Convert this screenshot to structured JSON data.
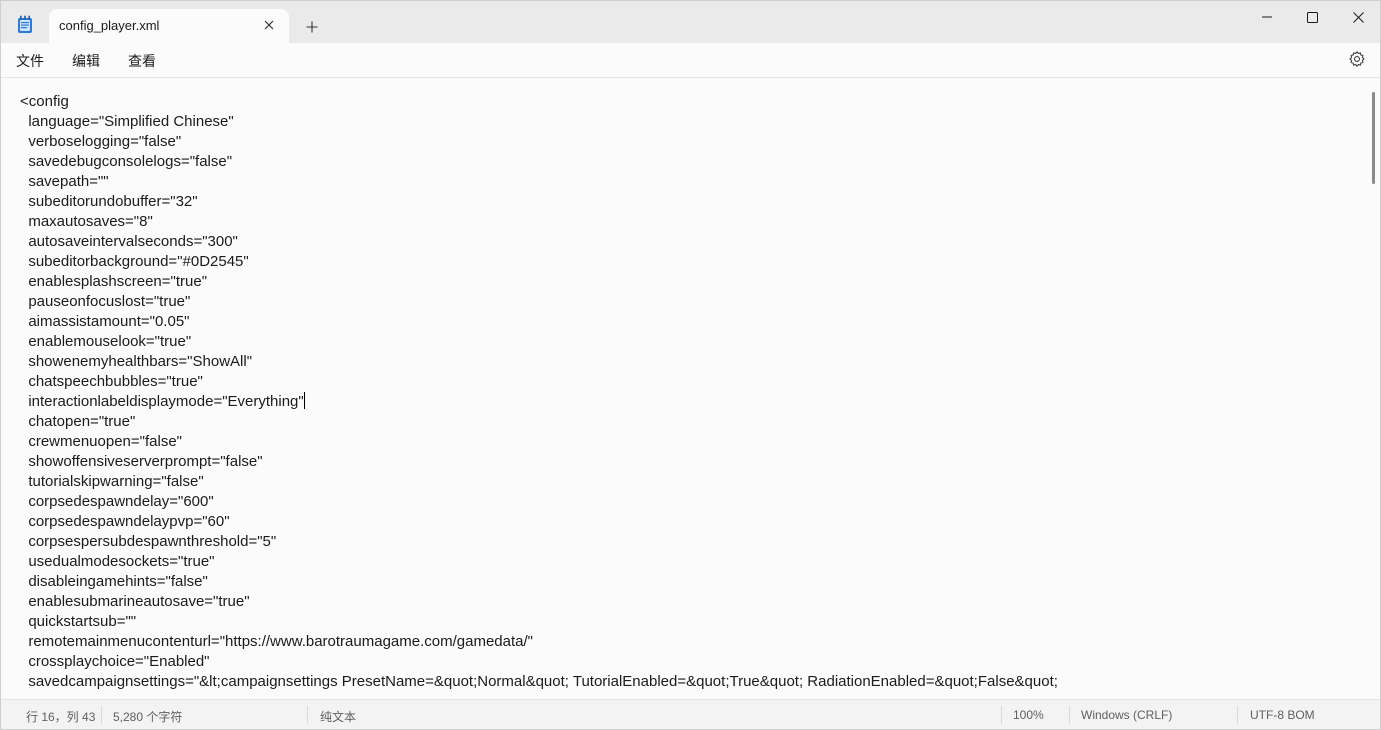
{
  "window": {
    "tab_title": "config_player.xml",
    "new_tab_symbol": "+",
    "controls": {
      "minimize": "minimize-icon",
      "maximize": "maximize-icon",
      "close": "close-icon"
    }
  },
  "menu": {
    "file": "文件",
    "edit": "编辑",
    "view": "查看"
  },
  "editor": {
    "caret_line": 16,
    "lines": [
      "<config",
      "  language=\"Simplified Chinese\"",
      "  verboselogging=\"false\"",
      "  savedebugconsolelogs=\"false\"",
      "  savepath=\"\"",
      "  subeditorundobuffer=\"32\"",
      "  maxautosaves=\"8\"",
      "  autosaveintervalseconds=\"300\"",
      "  subeditorbackground=\"#0D2545\"",
      "  enablesplashscreen=\"true\"",
      "  pauseonfocuslost=\"true\"",
      "  aimassistamount=\"0.05\"",
      "  enablemouselook=\"true\"",
      "  showenemyhealthbars=\"ShowAll\"",
      "  chatspeechbubbles=\"true\"",
      "  interactionlabeldisplaymode=\"Everything\"",
      "  chatopen=\"true\"",
      "  crewmenuopen=\"false\"",
      "  showoffensiveserverprompt=\"false\"",
      "  tutorialskipwarning=\"false\"",
      "  corpsedespawndelay=\"600\"",
      "  corpsedespawndelaypvp=\"60\"",
      "  corpsespersubdespawnthreshold=\"5\"",
      "  usedualmodesockets=\"true\"",
      "  disableingamehints=\"false\"",
      "  enablesubmarineautosave=\"true\"",
      "  quickstartsub=\"\"",
      "  remotemainmenucontenturl=\"https://www.barotraumagame.com/gamedata/\"",
      "  crossplaychoice=\"Enabled\"",
      "  savedcampaignsettings=\"&lt;campaignsettings PresetName=&quot;Normal&quot; TutorialEnabled=&quot;True&quot; RadiationEnabled=&quot;False&quot;"
    ]
  },
  "status": {
    "position": "行 16，列 43",
    "char_count": "5,280 个字符",
    "format": "纯文本",
    "zoom": "100%",
    "line_ending": "Windows (CRLF)",
    "encoding": "UTF-8 BOM"
  },
  "colors": {
    "titlebar_bg": "#eaeaea",
    "editor_bg": "#fbfbfb",
    "statusbar_bg": "#f3f3f3",
    "icon_blue": "#1f6fd0"
  }
}
